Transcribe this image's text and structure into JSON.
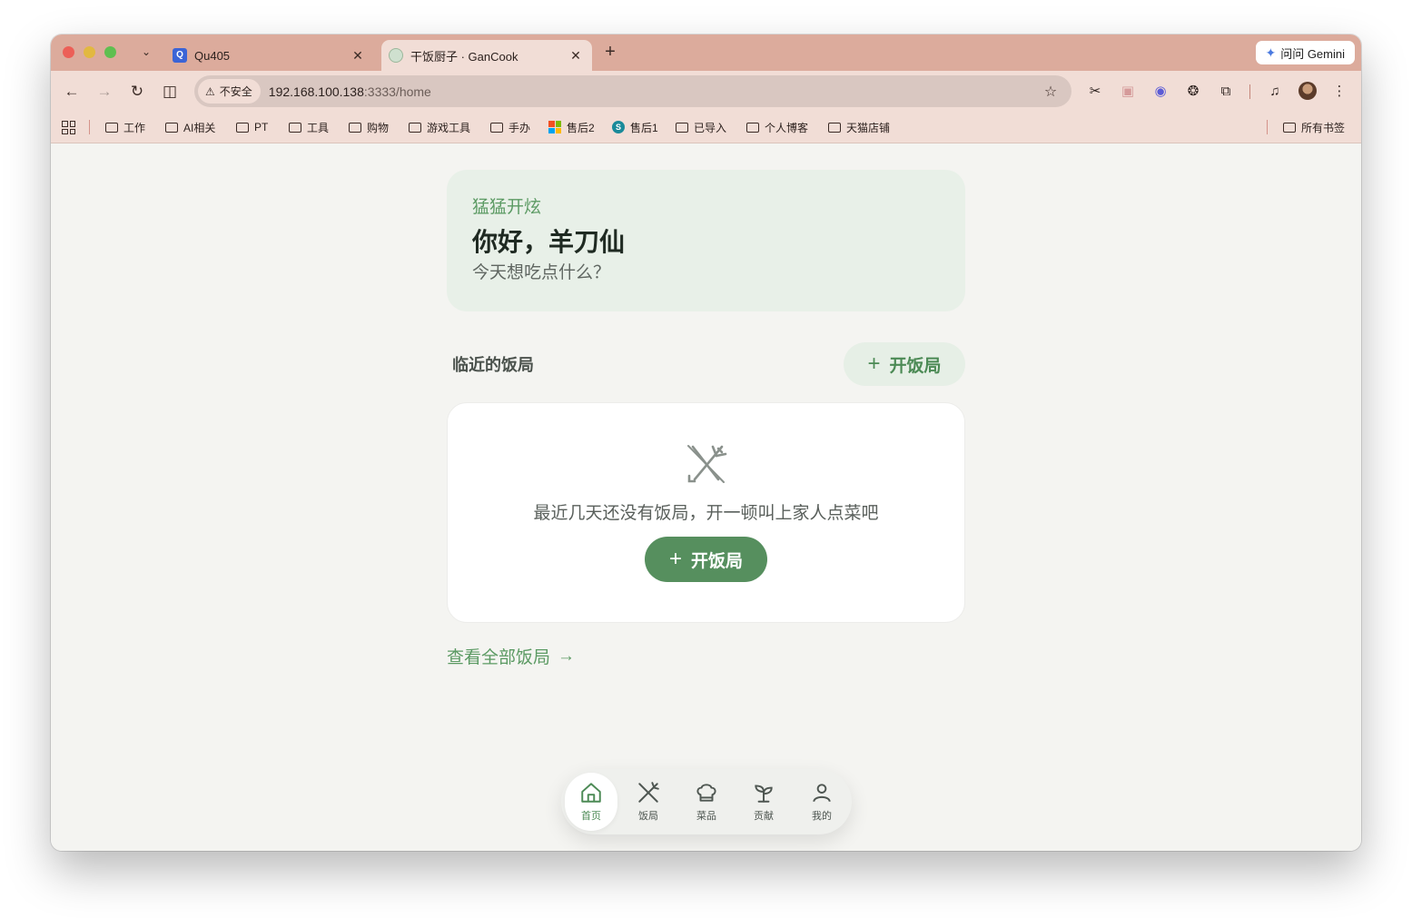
{
  "browser": {
    "tabs": [
      {
        "title": "Qu405",
        "favicon_text": "Q"
      },
      {
        "title": "干饭厨子 · GanCook"
      }
    ],
    "gemini_label": "问问 Gemini",
    "security_label": "不安全",
    "url_host": "192.168.100.138",
    "url_path": ":3333/home",
    "bookmarks": [
      {
        "label": "工作"
      },
      {
        "label": "AI相关"
      },
      {
        "label": "PT"
      },
      {
        "label": "工具"
      },
      {
        "label": "购物"
      },
      {
        "label": "游戏工具"
      },
      {
        "label": "手办"
      },
      {
        "label": "售后2"
      },
      {
        "label": "售后1"
      },
      {
        "label": "已导入"
      },
      {
        "label": "个人博客"
      },
      {
        "label": "天猫店铺"
      }
    ],
    "all_bookmarks_label": "所有书签"
  },
  "greeting": {
    "tagline": "猛猛开炫",
    "title": "你好，羊刀仙",
    "question": "今天想吃点什么？"
  },
  "section": {
    "title": "临近的饭局",
    "open_button": "开饭局"
  },
  "empty_state": {
    "message": "最近几天还没有饭局，开一顿叫上家人点菜吧",
    "open_button": "开饭局"
  },
  "view_all": "查看全部饭局",
  "bottom_nav": [
    {
      "label": "首页",
      "icon": "home-icon",
      "active": true
    },
    {
      "label": "饭局",
      "icon": "utensils-icon",
      "active": false
    },
    {
      "label": "菜品",
      "icon": "chef-hat-icon",
      "active": false
    },
    {
      "label": "贡献",
      "icon": "sprout-icon",
      "active": false
    },
    {
      "label": "我的",
      "icon": "user-icon",
      "active": false
    }
  ],
  "colors": {
    "accent": "#568f5e",
    "accent_light": "#e8f0e8",
    "tab_strip": "#dcab9c",
    "toolbar": "#f1ddd6"
  }
}
